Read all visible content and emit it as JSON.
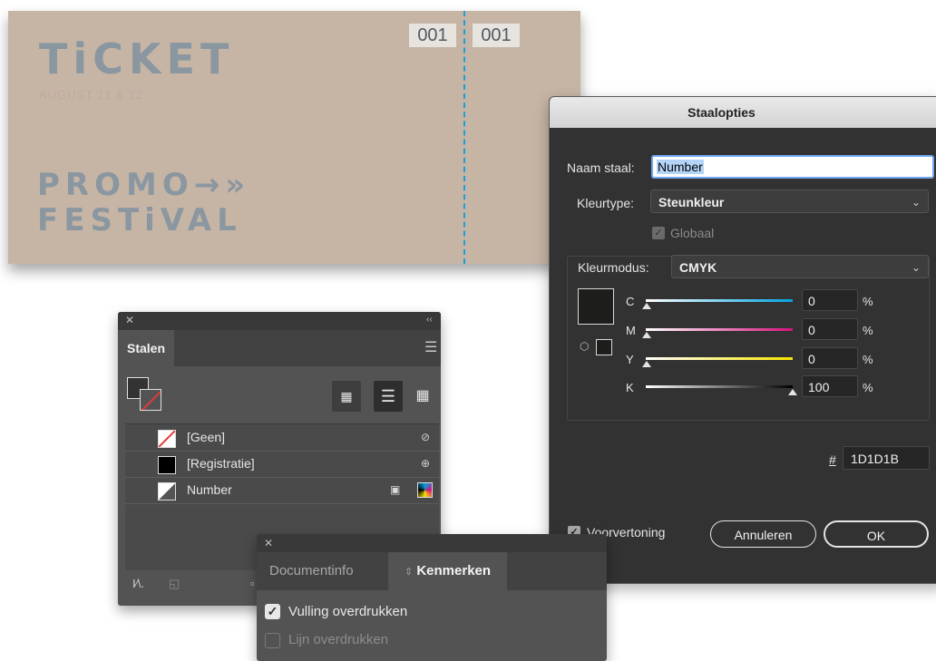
{
  "ticket": {
    "title": "TiCKET",
    "date": "AUGUST 11 & 12",
    "promo_line1": "PROMO→»",
    "promo_line2": "FESTiVAL",
    "number_left": "001",
    "number_right": "001",
    "accent_color": "#1a9fde"
  },
  "dialog": {
    "title": "Staalopties",
    "naam_label": "Naam staal:",
    "naam_value": "Number",
    "kleurtype_label": "Kleurtype:",
    "kleurtype_value": "Steunkleur",
    "globaal_label": "Globaal",
    "kleurmodus_label": "Kleurmodus:",
    "kleurmodus_value": "CMYK",
    "channels": [
      {
        "label": "C",
        "value": "0",
        "unit": "%",
        "level": 0
      },
      {
        "label": "M",
        "value": "0",
        "unit": "%",
        "level": 0
      },
      {
        "label": "Y",
        "value": "0",
        "unit": "%",
        "level": 0
      },
      {
        "label": "K",
        "value": "100",
        "unit": "%",
        "level": 100
      }
    ],
    "hex_label": "#",
    "hex_value": "1D1D1B",
    "swatch_color": "#1d1d1b",
    "preview_label": "Voorvertoning",
    "cancel_label": "Annuleren",
    "ok_label": "OK"
  },
  "stalen": {
    "tab_label": "Stalen",
    "swatches": [
      {
        "name": "[Geen]",
        "color": "none",
        "icon": "no-edit-icon"
      },
      {
        "name": "[Registratie]",
        "color": "#000000",
        "icon": "registration-icon"
      },
      {
        "name": "Number",
        "color": "#555555",
        "icon": "spot-color-icon"
      }
    ]
  },
  "kenmerken": {
    "tab_docinfo": "Documentinfo",
    "tab_kenmerken": "Kenmerken",
    "vulling_label": "Vulling overdrukken",
    "lijn_label": "Lijn overdrukken"
  }
}
